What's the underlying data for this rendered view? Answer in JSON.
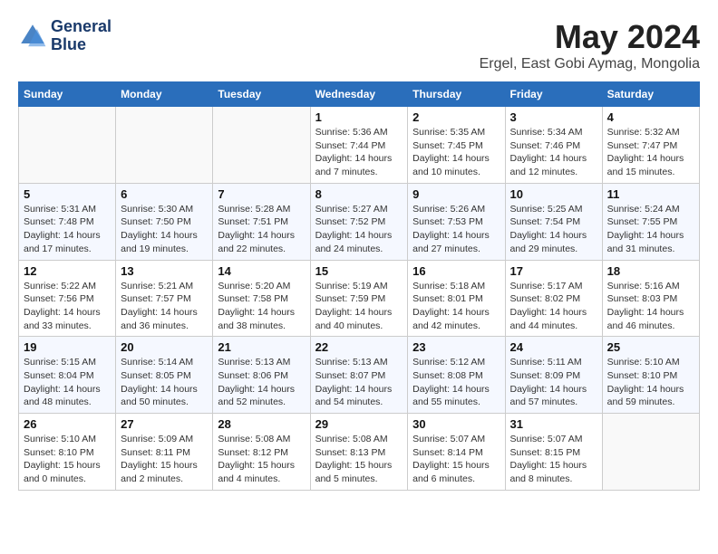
{
  "header": {
    "logo_line1": "General",
    "logo_line2": "Blue",
    "month": "May 2024",
    "location": "Ergel, East Gobi Aymag, Mongolia"
  },
  "weekdays": [
    "Sunday",
    "Monday",
    "Tuesday",
    "Wednesday",
    "Thursday",
    "Friday",
    "Saturday"
  ],
  "weeks": [
    [
      {
        "day": "",
        "info": ""
      },
      {
        "day": "",
        "info": ""
      },
      {
        "day": "",
        "info": ""
      },
      {
        "day": "1",
        "info": "Sunrise: 5:36 AM\nSunset: 7:44 PM\nDaylight: 14 hours\nand 7 minutes."
      },
      {
        "day": "2",
        "info": "Sunrise: 5:35 AM\nSunset: 7:45 PM\nDaylight: 14 hours\nand 10 minutes."
      },
      {
        "day": "3",
        "info": "Sunrise: 5:34 AM\nSunset: 7:46 PM\nDaylight: 14 hours\nand 12 minutes."
      },
      {
        "day": "4",
        "info": "Sunrise: 5:32 AM\nSunset: 7:47 PM\nDaylight: 14 hours\nand 15 minutes."
      }
    ],
    [
      {
        "day": "5",
        "info": "Sunrise: 5:31 AM\nSunset: 7:48 PM\nDaylight: 14 hours\nand 17 minutes."
      },
      {
        "day": "6",
        "info": "Sunrise: 5:30 AM\nSunset: 7:50 PM\nDaylight: 14 hours\nand 19 minutes."
      },
      {
        "day": "7",
        "info": "Sunrise: 5:28 AM\nSunset: 7:51 PM\nDaylight: 14 hours\nand 22 minutes."
      },
      {
        "day": "8",
        "info": "Sunrise: 5:27 AM\nSunset: 7:52 PM\nDaylight: 14 hours\nand 24 minutes."
      },
      {
        "day": "9",
        "info": "Sunrise: 5:26 AM\nSunset: 7:53 PM\nDaylight: 14 hours\nand 27 minutes."
      },
      {
        "day": "10",
        "info": "Sunrise: 5:25 AM\nSunset: 7:54 PM\nDaylight: 14 hours\nand 29 minutes."
      },
      {
        "day": "11",
        "info": "Sunrise: 5:24 AM\nSunset: 7:55 PM\nDaylight: 14 hours\nand 31 minutes."
      }
    ],
    [
      {
        "day": "12",
        "info": "Sunrise: 5:22 AM\nSunset: 7:56 PM\nDaylight: 14 hours\nand 33 minutes."
      },
      {
        "day": "13",
        "info": "Sunrise: 5:21 AM\nSunset: 7:57 PM\nDaylight: 14 hours\nand 36 minutes."
      },
      {
        "day": "14",
        "info": "Sunrise: 5:20 AM\nSunset: 7:58 PM\nDaylight: 14 hours\nand 38 minutes."
      },
      {
        "day": "15",
        "info": "Sunrise: 5:19 AM\nSunset: 7:59 PM\nDaylight: 14 hours\nand 40 minutes."
      },
      {
        "day": "16",
        "info": "Sunrise: 5:18 AM\nSunset: 8:01 PM\nDaylight: 14 hours\nand 42 minutes."
      },
      {
        "day": "17",
        "info": "Sunrise: 5:17 AM\nSunset: 8:02 PM\nDaylight: 14 hours\nand 44 minutes."
      },
      {
        "day": "18",
        "info": "Sunrise: 5:16 AM\nSunset: 8:03 PM\nDaylight: 14 hours\nand 46 minutes."
      }
    ],
    [
      {
        "day": "19",
        "info": "Sunrise: 5:15 AM\nSunset: 8:04 PM\nDaylight: 14 hours\nand 48 minutes."
      },
      {
        "day": "20",
        "info": "Sunrise: 5:14 AM\nSunset: 8:05 PM\nDaylight: 14 hours\nand 50 minutes."
      },
      {
        "day": "21",
        "info": "Sunrise: 5:13 AM\nSunset: 8:06 PM\nDaylight: 14 hours\nand 52 minutes."
      },
      {
        "day": "22",
        "info": "Sunrise: 5:13 AM\nSunset: 8:07 PM\nDaylight: 14 hours\nand 54 minutes."
      },
      {
        "day": "23",
        "info": "Sunrise: 5:12 AM\nSunset: 8:08 PM\nDaylight: 14 hours\nand 55 minutes."
      },
      {
        "day": "24",
        "info": "Sunrise: 5:11 AM\nSunset: 8:09 PM\nDaylight: 14 hours\nand 57 minutes."
      },
      {
        "day": "25",
        "info": "Sunrise: 5:10 AM\nSunset: 8:10 PM\nDaylight: 14 hours\nand 59 minutes."
      }
    ],
    [
      {
        "day": "26",
        "info": "Sunrise: 5:10 AM\nSunset: 8:10 PM\nDaylight: 15 hours\nand 0 minutes."
      },
      {
        "day": "27",
        "info": "Sunrise: 5:09 AM\nSunset: 8:11 PM\nDaylight: 15 hours\nand 2 minutes."
      },
      {
        "day": "28",
        "info": "Sunrise: 5:08 AM\nSunset: 8:12 PM\nDaylight: 15 hours\nand 4 minutes."
      },
      {
        "day": "29",
        "info": "Sunrise: 5:08 AM\nSunset: 8:13 PM\nDaylight: 15 hours\nand 5 minutes."
      },
      {
        "day": "30",
        "info": "Sunrise: 5:07 AM\nSunset: 8:14 PM\nDaylight: 15 hours\nand 6 minutes."
      },
      {
        "day": "31",
        "info": "Sunrise: 5:07 AM\nSunset: 8:15 PM\nDaylight: 15 hours\nand 8 minutes."
      },
      {
        "day": "",
        "info": ""
      }
    ]
  ]
}
